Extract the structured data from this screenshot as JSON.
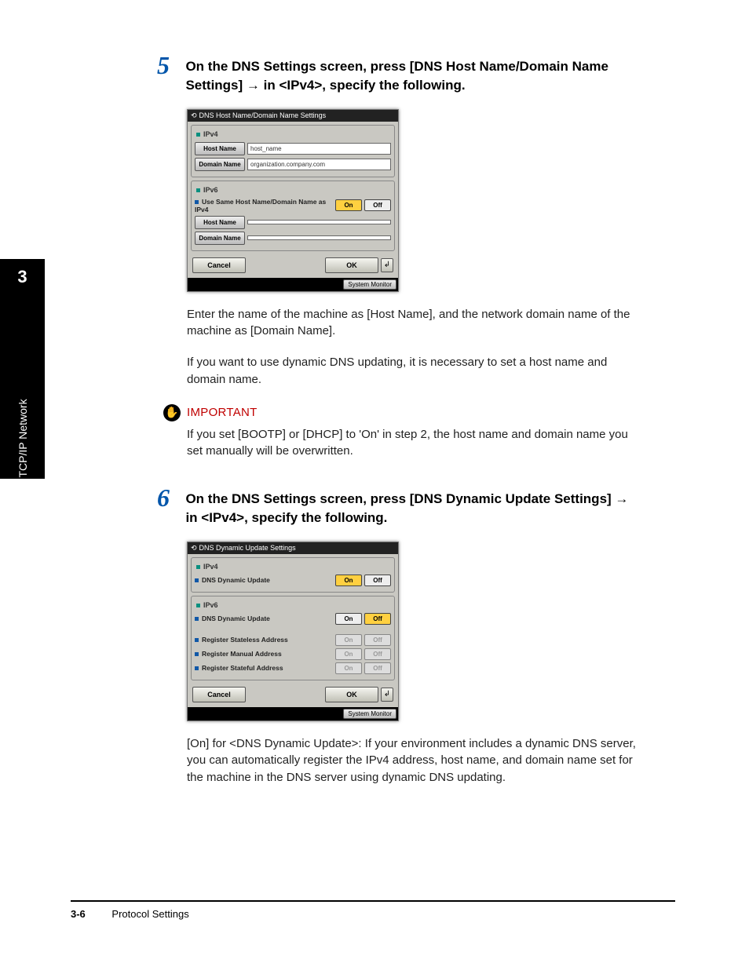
{
  "tab": {
    "number": "3",
    "label": "Using a TCP/IP Network"
  },
  "steps": [
    {
      "number": "5",
      "heading_a": "On the DNS Settings screen, press [DNS Host Name/Domain Name Settings] ",
      "heading_b": " in <IPv4>, specify the following.",
      "arrow": "→",
      "screenshot": {
        "title": "DNS Host Name/Domain Name Settings",
        "ipv4_label": "IPv4",
        "host_name_btn": "Host Name",
        "host_name_val": "host_name",
        "domain_name_btn": "Domain Name",
        "domain_name_val": "organization.company.com",
        "ipv6_label": "IPv6",
        "same_host_label": "Use Same Host Name/Domain Name as IPv4",
        "on": "On",
        "off": "Off",
        "host_name_btn2": "Host Name",
        "domain_name_btn2": "Domain Name",
        "cancel": "Cancel",
        "ok": "OK",
        "sysmon": "System Monitor"
      },
      "para1": "Enter the name of the machine as [Host Name], and the network domain name of the machine as [Domain Name].",
      "para2": "If you want to use dynamic DNS updating, it is necessary to set a host name and domain name.",
      "important_label": "IMPORTANT",
      "important_text": "If you set [BOOTP] or [DHCP] to 'On' in step 2, the host name and domain name you set manually will be overwritten."
    },
    {
      "number": "6",
      "heading_a": "On the DNS Settings screen, press [DNS Dynamic Update Settings] ",
      "heading_b": " in <IPv4>, specify the following.",
      "arrow": "→",
      "screenshot": {
        "title": "DNS Dynamic Update Settings",
        "ipv4_label": "IPv4",
        "dns_dyn4": "DNS Dynamic Update",
        "ipv6_label": "IPv6",
        "dns_dyn6": "DNS Dynamic Update",
        "reg_stateless": "Register Stateless Address",
        "reg_manual": "Register Manual Address",
        "reg_stateful": "Register Stateful Address",
        "on": "On",
        "off": "Off",
        "cancel": "Cancel",
        "ok": "OK",
        "sysmon": "System Monitor"
      },
      "para1": "[On] for <DNS Dynamic Update>: If your environment includes a dynamic DNS server, you can automatically register the IPv4 address, host name, and domain name set for the machine in the DNS server using dynamic DNS updating."
    }
  ],
  "footer": {
    "page": "3-6",
    "section": "Protocol Settings"
  }
}
